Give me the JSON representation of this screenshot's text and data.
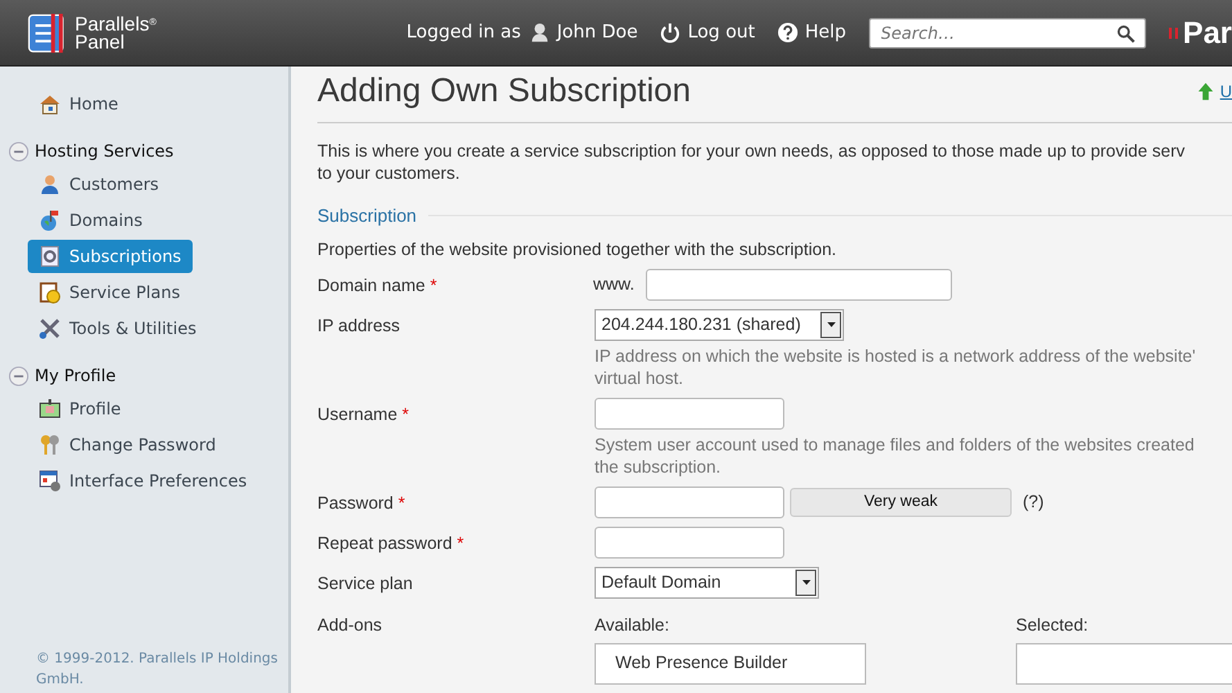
{
  "header": {
    "logo": {
      "line_1": "Parallels",
      "line_2": "Panel",
      "mark": "®"
    },
    "logged_in_label": "Logged in as",
    "user": "John Doe",
    "logout": "Log out",
    "help": "Help",
    "search": {
      "placeholder": "Search…"
    },
    "brand": "Par"
  },
  "sidebar": {
    "home": "Home",
    "groups": [
      {
        "title": "Hosting Services",
        "expanded": true,
        "items": [
          {
            "label": "Customers",
            "selected": false
          },
          {
            "label": "Domains",
            "selected": false
          },
          {
            "label": "Subscriptions",
            "selected": true
          },
          {
            "label": "Service Plans",
            "selected": false
          },
          {
            "label": "Tools & Utilities",
            "selected": false
          }
        ]
      },
      {
        "title": "My Profile",
        "expanded": true,
        "items": [
          {
            "label": "Profile",
            "selected": false
          },
          {
            "label": "Change Password",
            "selected": false
          },
          {
            "label": "Interface Preferences",
            "selected": false
          }
        ]
      }
    ],
    "copyright": "© 1999-2012. Parallels IP Holdings GmbH."
  },
  "page": {
    "title": "Adding Own Subscription",
    "up_link": "U",
    "description_lines": [
      "This is where you create a service subscription for your own needs, as opposed to those made up to provide serv",
      "to your customers."
    ],
    "section": {
      "title": "Subscription",
      "description": "Properties of the website provisioned together with the subscription."
    },
    "fields": [
      {
        "kind": "text",
        "label": "Domain name",
        "required_mark": "*",
        "prefix": "www."
      },
      {
        "kind": "select",
        "label": "IP address",
        "value": "204.244.180.231 (shared)",
        "hint_lines": [
          "IP address on which the website is hosted is a network address of the website'",
          "virtual host."
        ]
      },
      {
        "kind": "text",
        "label": "Username",
        "required_mark": "*",
        "hint_lines": [
          "System user account used to manage files and folders of the websites created",
          "the subscription."
        ]
      },
      {
        "kind": "password",
        "label": "Password",
        "required_mark": "*",
        "strength": "Very weak",
        "help": "(?)"
      },
      {
        "kind": "text",
        "label": "Repeat password",
        "required_mark": "*"
      },
      {
        "kind": "select",
        "label": "Service plan",
        "value": "Default Domain"
      },
      {
        "kind": "addons",
        "label": "Add-ons",
        "available_label": "Available:",
        "selected_label": "Selected:",
        "available_items": [
          "Web Presence Builder"
        ]
      }
    ]
  }
}
